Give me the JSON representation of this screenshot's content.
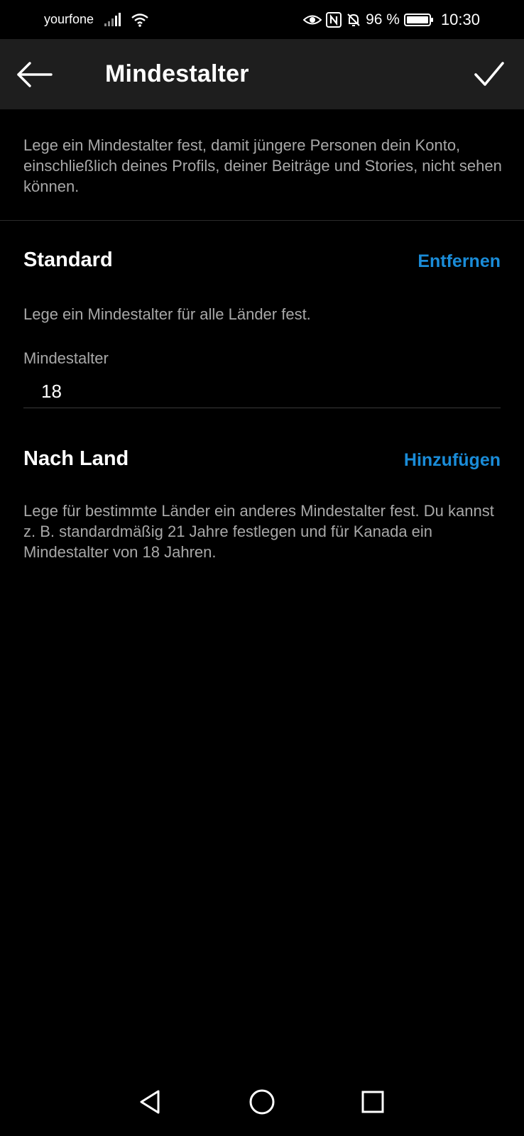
{
  "status_bar": {
    "carrier": "yourfone",
    "battery": "96 %",
    "time": "10:30",
    "icons": [
      "signal-icon",
      "wifi-icon",
      "eye-icon",
      "nfc-icon",
      "bell-off-icon",
      "battery-icon"
    ]
  },
  "app_bar": {
    "title": "Mindestalter",
    "back_icon": "arrow-left-icon",
    "confirm_icon": "checkmark-icon"
  },
  "intro": {
    "text": "Lege ein Mindestalter fest, damit jüngere Personen dein Konto, einschließlich deines Profils, deiner Beiträge und Stories, nicht sehen können."
  },
  "standard": {
    "heading": "Standard",
    "action": "Entfernen",
    "description": "Lege ein Mindestalter für alle Länder fest.",
    "field_label": "Mindestalter",
    "field_value": "18"
  },
  "by_country": {
    "heading": "Nach Land",
    "action": "Hinzufügen",
    "description": "Lege für bestimmte Länder ein anderes Mindestalter fest. Du kannst z. B. standardmäßig 21 Jahre festlegen und für Kanada ein Mindestalter von 18 Jahren."
  },
  "nav_bar": {
    "icons": [
      "back-triangle-icon",
      "home-circle-icon",
      "recents-square-icon"
    ]
  },
  "colors": {
    "background": "#000000",
    "app_bar": "#1e1e1e",
    "accent": "#1a8cd8",
    "secondary_text": "#a8a8a8"
  }
}
